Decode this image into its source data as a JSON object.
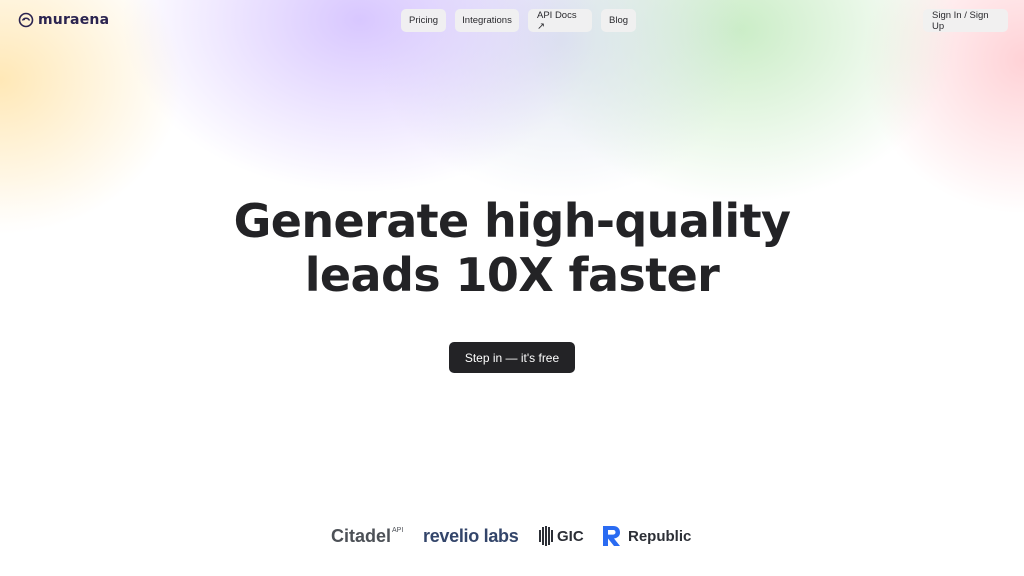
{
  "brand": {
    "logo_text": "muraena"
  },
  "nav": {
    "pricing": "Pricing",
    "integrations": "Integrations",
    "api_docs": "API Docs ↗",
    "blog": "Blog",
    "sign_in": "Sign In / Sign Up"
  },
  "hero": {
    "title_line1": "Generate high-quality",
    "title_line2": "leads 10X faster",
    "cta": "Step in — it's free"
  },
  "logos": {
    "citadel": "Citadel",
    "citadel_sup": "API",
    "revelio": "revelio labs",
    "gic": "GIC",
    "republic": "Republic"
  },
  "colors": {
    "cta_bg": "#232326",
    "title_text": "#232326",
    "logo_text": "#2b2450",
    "republic_blue": "#2a6bf2"
  }
}
